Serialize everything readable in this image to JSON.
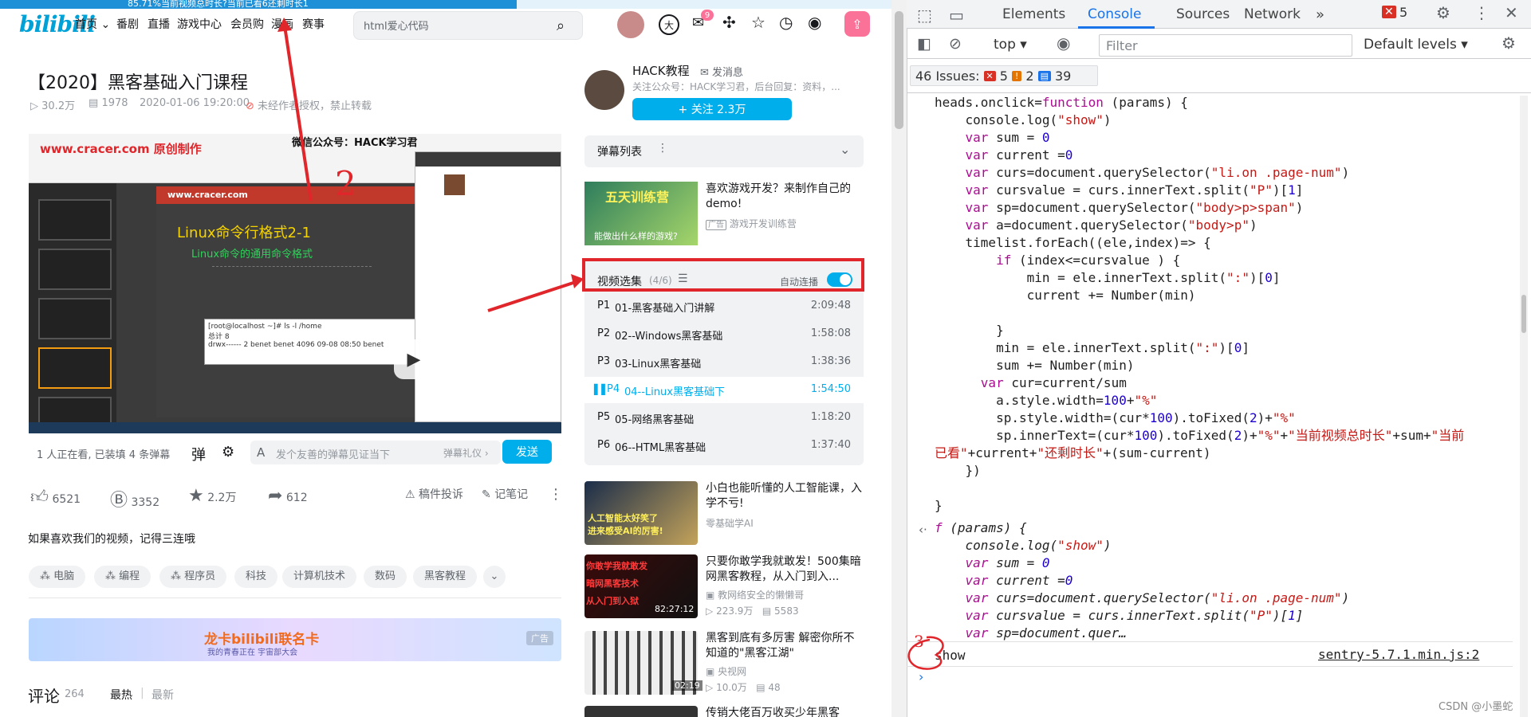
{
  "progress_text": "85.71%当前视频总时长?当前已看6还剩时长1",
  "progress_fraction": 0.58,
  "header": {
    "logo": "bilibili",
    "nav": [
      "首页",
      "番剧",
      "直播",
      "游戏中心",
      "会员购",
      "漫画",
      "赛事"
    ],
    "search_placeholder": "html爱心代码",
    "msg_badge": "9"
  },
  "video": {
    "title": "【2020】黑客基础入门课程",
    "views": "30.2万",
    "danmaku": "1978",
    "date": "2020-01-06 19:20:00",
    "copyright": "未经作者授权，禁止转载",
    "player_watermark": "www.cracer.com 原创制作",
    "player_caption": "微信公众号：HACK学习君",
    "slide_title": "Linux命令行格式2-1",
    "slide_sub": "Linux命令的通用命令格式",
    "slide_brand": "www.cracer.com",
    "terminal_cmd": "[root@localhost ~]# ls -l /home",
    "terminal_line2": "总计 8",
    "terminal_line3": "drwx------ 2 benet benet 4096 09-08 08:50 benet",
    "annotation_number": "2",
    "watching": "1 人正在看, 已装填 4 条弹幕",
    "danmu_placeholder": "发个友善的弹幕见证当下",
    "danmu_etiquette": "弹幕礼仪 ›",
    "send": "发送",
    "likes": "6521",
    "coins": "3352",
    "favs": "2.2万",
    "shares": "612",
    "report": "稿件投诉",
    "notes": "记笔记",
    "desc": "如果喜欢我们的视频，记得三连哦",
    "tags": [
      "电脑",
      "编程",
      "程序员",
      "科技",
      "计算机技术",
      "数码",
      "黑客教程"
    ],
    "banner_text": "龙卡bilibili联名卡",
    "banner_sub": "我的青春正在 宇宙部大会",
    "banner_tag": "广告",
    "comments_title": "评论",
    "comments_count": "264",
    "sort_hot": "最热",
    "sort_new": "最新"
  },
  "uploader": {
    "name": "HACK教程",
    "message": "发消息",
    "desc": "关注公众号：HACK学习君，后台回复：资料，...",
    "follow": "+ 关注 2.3万"
  },
  "danmu_list": "弹幕列表",
  "ad": {
    "title": "喜欢游戏开发？来制作自己的demo!",
    "badge": "广告",
    "source": "游戏开发训练营",
    "thumb_text": "五天训练营",
    "thumb_sub": "能做出什么样的游戏?"
  },
  "playlist": {
    "title": "视频选集",
    "count": "(4/6)",
    "autoplay": "自动连播",
    "items": [
      {
        "p": "P1",
        "name": "01-黑客基础入门讲解",
        "dur": "2:09:48"
      },
      {
        "p": "P2",
        "name": "02--Windows黑客基础",
        "dur": "1:58:08"
      },
      {
        "p": "P3",
        "name": "03-Linux黑客基础",
        "dur": "1:38:36"
      },
      {
        "p": "P4",
        "name": "04--Linux黑客基础下",
        "dur": "1:54:50"
      },
      {
        "p": "P5",
        "name": "05-网络黑客基础",
        "dur": "1:18:20"
      },
      {
        "p": "P6",
        "name": "06--HTML黑客基础",
        "dur": "1:37:40"
      }
    ]
  },
  "recommend": [
    {
      "title": "小白也能听懂的人工智能课，入学不亏!",
      "author": "零基础学AI",
      "views": "",
      "danmu": "",
      "dur": "",
      "thumb": "人工智能太好笑了\n进来感受AI的厉害!"
    },
    {
      "title": "只要你敢学我就敢发！500集暗网黑客教程，从入门到入...",
      "author": "教网络安全的懒懒哥",
      "views": "223.9万",
      "danmu": "5583",
      "dur": "82:27:12",
      "thumb": "你敢学我就敢发\n暗网黑客技术\n从入门到入狱"
    },
    {
      "title": "黑客到底有多厉害 解密你所不知道的\"黑客江湖\"",
      "author": "央视网",
      "views": "10.0万",
      "danmu": "48",
      "dur": "02:19",
      "thumb": ""
    },
    {
      "title": "传销大佬百万收买少年黑客",
      "author": "",
      "views": "",
      "danmu": "",
      "dur": "",
      "thumb": ""
    }
  ],
  "devtools": {
    "tabs": [
      "Elements",
      "Console",
      "Sources",
      "Network"
    ],
    "error_count": "5",
    "context": "top",
    "filter_placeholder": "Filter",
    "levels": "Default levels",
    "issues_label": "46 Issues:",
    "issues_err": "5",
    "issues_warn": "2",
    "issues_info": "39",
    "source_link": "sentry-5.7.1.min.js:2",
    "log_output": "show",
    "watermark": "CSDN @小墨蛇",
    "annotation_number": "3"
  },
  "colors": {
    "bili_blue": "#00a1d6",
    "accent": "#00aeec",
    "pink": "#fb7299",
    "annot_red": "#e0262b"
  }
}
